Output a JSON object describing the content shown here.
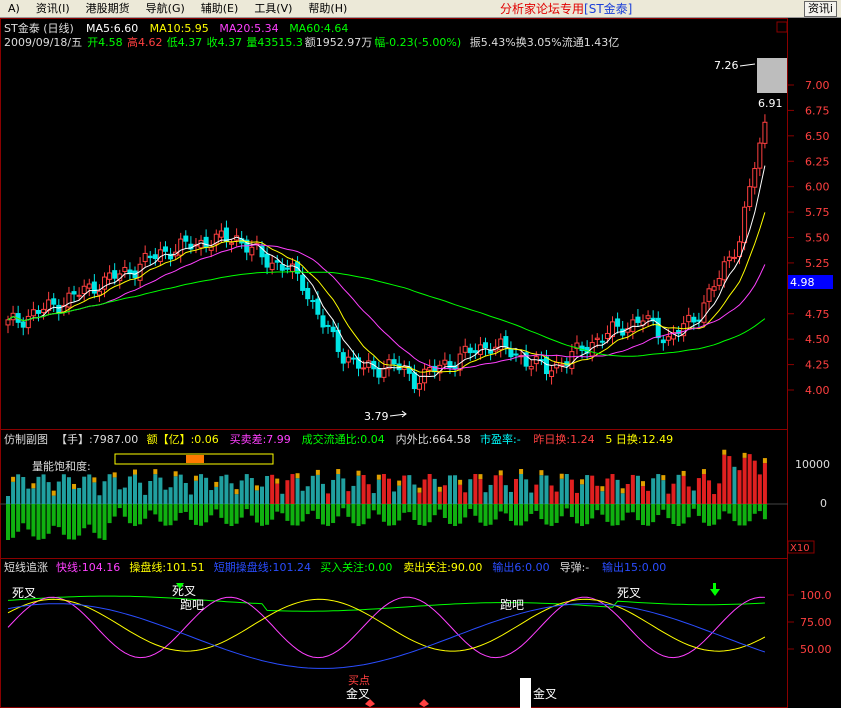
{
  "menu": {
    "items": [
      "A)",
      "资讯(I)",
      "港股期货",
      "导航(G)",
      "辅助(E)",
      "工具(V)",
      "帮助(H)"
    ],
    "banner_text": "分析家论坛专用",
    "banner_stock": "[ST金泰]",
    "info_button": "资讯i"
  },
  "price_panel": {
    "title": "ST金泰 (日线)",
    "ma_labels": [
      {
        "text": "MA5:6.60",
        "color": "#ffffff"
      },
      {
        "text": "MA10:5.95",
        "color": "#ffff00"
      },
      {
        "text": "MA20:5.34",
        "color": "#ff40ff"
      },
      {
        "text": "MA60:4.64",
        "color": "#00ff00"
      }
    ],
    "info_line": [
      {
        "text": "2009/09/18/五",
        "color": "#dddddd"
      },
      {
        "text": "开4.58",
        "color": "#00ff00"
      },
      {
        "text": "高4.62",
        "color": "#ff4040"
      },
      {
        "text": "低4.37",
        "color": "#00ff00"
      },
      {
        "text": "收4.37",
        "color": "#00ff00"
      },
      {
        "text": "量43515.3",
        "color": "#00ff00"
      },
      {
        "text": "额1952.97万",
        "color": "#dddddd"
      },
      {
        "text": "幅-0.23(-5.00%)",
        "color": "#00ff00"
      },
      {
        "text": "振5.43%",
        "color": "#dddddd"
      },
      {
        "text": "换3.05%",
        "color": "#dddddd"
      },
      {
        "text": "流通1.43亿",
        "color": "#dddddd"
      }
    ],
    "price_ticks": [
      "7.00",
      "6.75",
      "6.50",
      "6.25",
      "6.00",
      "5.75",
      "5.50",
      "5.25",
      "4.75",
      "4.50",
      "4.25",
      "4.00"
    ],
    "current_price": "4.98",
    "annotation_high": "7.26",
    "annotation_high2": "6.91",
    "annotation_low": "3.79"
  },
  "volume_panel": {
    "header": [
      {
        "text": "仿制副图",
        "color": "#dddddd"
      },
      {
        "text": "【手】:7987.00",
        "color": "#dddddd"
      },
      {
        "text": "额【亿】:0.06",
        "color": "#ffff00"
      },
      {
        "text": "买卖差:7.99",
        "color": "#ff40ff"
      },
      {
        "text": "成交流通比:0.04",
        "color": "#00ff00"
      },
      {
        "text": "内外比:664.58",
        "color": "#dddddd"
      },
      {
        "text": "市盈率:-",
        "color": "#00ffff"
      },
      {
        "text": "昨日换:1.24",
        "color": "#ff4040"
      },
      {
        "text": "5 日换:12.49",
        "color": "#ffff00"
      }
    ],
    "saturation_label": "量能饱和度:",
    "ticks": [
      "10000",
      "0"
    ],
    "multiplier": "X10"
  },
  "indicator_panel": {
    "header": [
      {
        "text": "短线追涨",
        "color": "#dddddd"
      },
      {
        "text": "快线:104.16",
        "color": "#ff40ff"
      },
      {
        "text": "操盘线:101.51",
        "color": "#ffff00"
      },
      {
        "text": "短期操盘线:101.24",
        "color": "#2a4dff"
      },
      {
        "text": "买入关注:0.00",
        "color": "#00ff00"
      },
      {
        "text": "卖出关注:90.00",
        "color": "#ffff00"
      },
      {
        "text": "输出6:0.00",
        "color": "#2a4dff"
      },
      {
        "text": "导弹:-",
        "color": "#dddddd"
      },
      {
        "text": "输出15:0.00",
        "color": "#2a4dff"
      }
    ],
    "ticks": [
      "100.0",
      "75.00",
      "50.00"
    ],
    "signals": [
      "死叉",
      "死叉",
      "跑吧",
      "跑吧",
      "死叉",
      "买点",
      "金叉",
      "金叉"
    ]
  }
}
